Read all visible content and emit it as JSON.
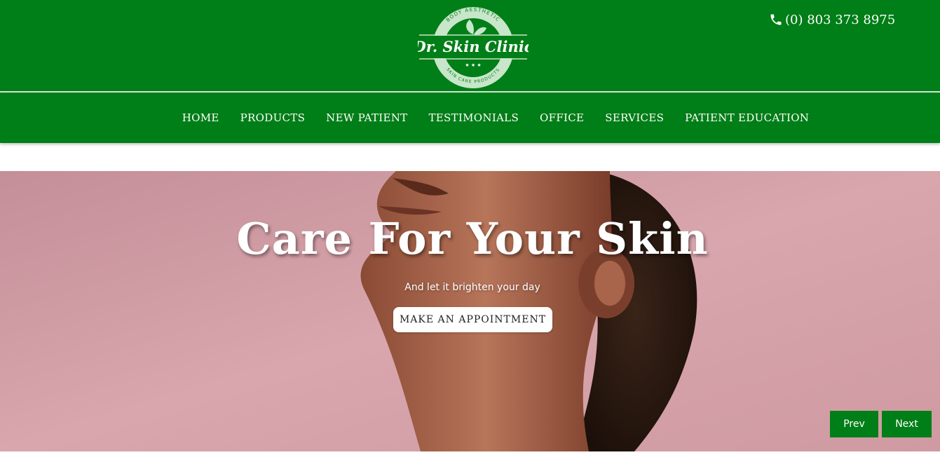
{
  "header": {
    "logo": {
      "arc_top": "BODY AESTHETIC",
      "name": "Dr. Skin Clinic",
      "arc_bottom": "SKIN CARE PRODUCTS",
      "stars": "★ ★ ★"
    },
    "phone": "(0) 803 373 8975",
    "phone_icon": "phone-icon"
  },
  "nav": {
    "items": [
      {
        "label": "HOME"
      },
      {
        "label": "PRODUCTS"
      },
      {
        "label": "NEW PATIENT"
      },
      {
        "label": "TESTIMONIALS"
      },
      {
        "label": "OFFICE"
      },
      {
        "label": "SERVICES"
      },
      {
        "label": "PATIENT EDUCATION"
      }
    ]
  },
  "hero": {
    "title": "Care For Your Skin",
    "subtitle": "And let it brighten your day",
    "cta_label": "MAKE AN APPOINTMENT",
    "prev_label": "Prev",
    "next_label": "Next"
  },
  "colors": {
    "brand_green": "#007e17",
    "hero_pink": "#d6a0a8",
    "white": "#ffffff"
  }
}
